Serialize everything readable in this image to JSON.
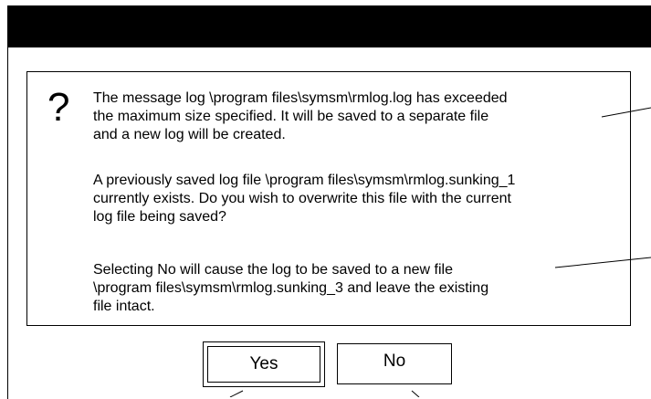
{
  "dialog": {
    "icon": "question-mark-icon",
    "icon_glyph": "?",
    "message_1": "The message log \\program files\\symsm\\rmlog.log has exceeded\nthe maximum size specified. It will be saved to a separate file\nand a new log will be created.",
    "message_2": "A previously saved log file \\program files\\symsm\\rmlog.sunking_1\ncurrently exists. Do you wish to overwrite this file with the current\nlog file being saved?",
    "message_3": "Selecting No will cause the log to be saved to a new file\n\\program files\\symsm\\rmlog.sunking_3 and leave the existing\nfile intact."
  },
  "buttons": {
    "yes_label": "Yes",
    "no_label": "No"
  }
}
